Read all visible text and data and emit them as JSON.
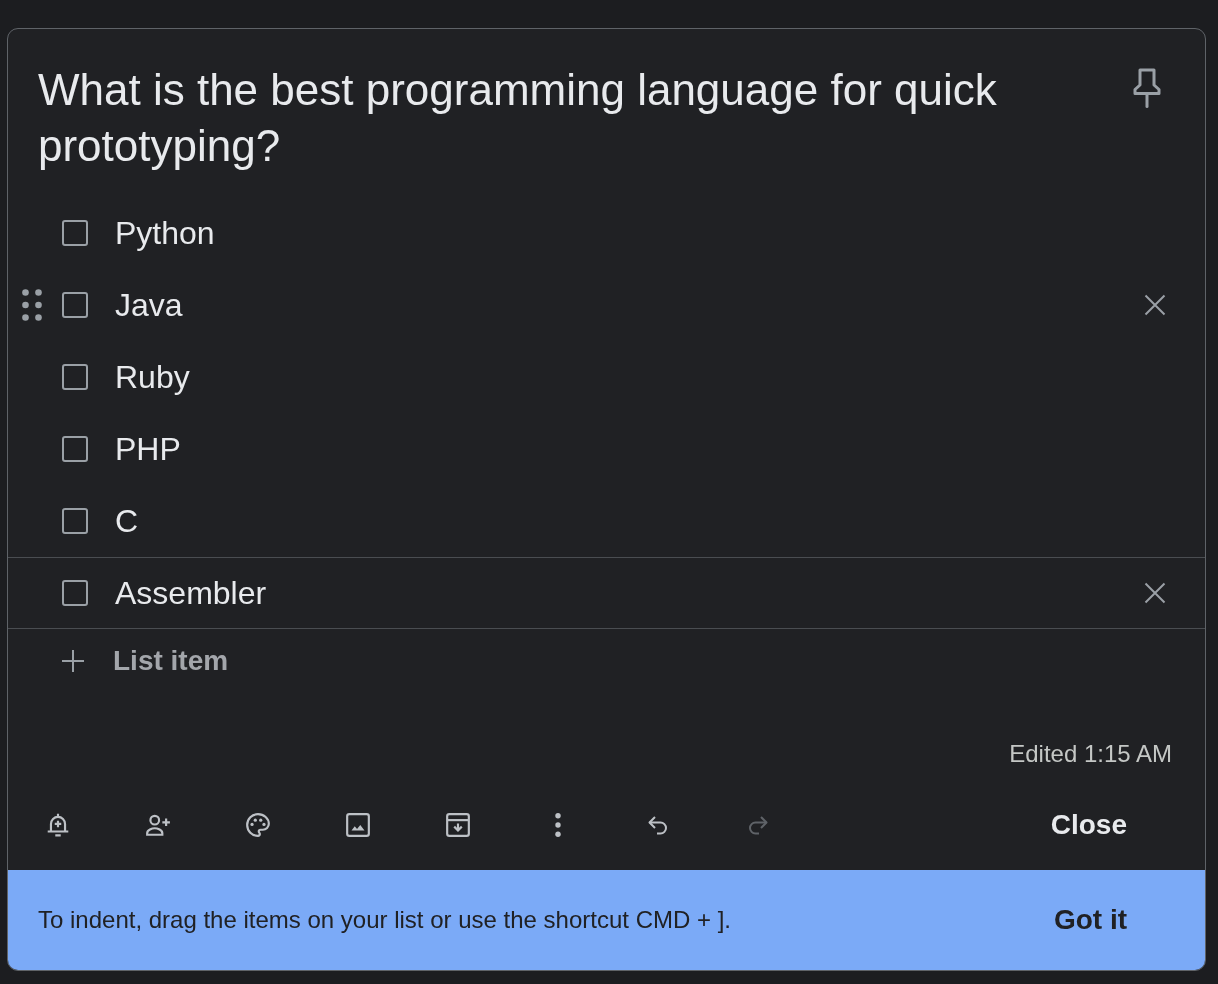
{
  "note": {
    "title": "What is the best programming language for quick prototyping?"
  },
  "items": [
    {
      "text": "Python",
      "checked": false,
      "hovered": false,
      "focused": false
    },
    {
      "text": "Java",
      "checked": false,
      "hovered": true,
      "focused": false
    },
    {
      "text": "Ruby",
      "checked": false,
      "hovered": false,
      "focused": false
    },
    {
      "text": "PHP",
      "checked": false,
      "hovered": false,
      "focused": false
    },
    {
      "text": "C",
      "checked": false,
      "hovered": false,
      "focused": false
    },
    {
      "text": "Assembler",
      "checked": false,
      "hovered": false,
      "focused": true
    }
  ],
  "new_item": {
    "placeholder": "List item"
  },
  "edited": "Edited 1:15 AM",
  "toolbar": [
    {
      "kind": "reminder",
      "disabled": false
    },
    {
      "kind": "collaborator",
      "disabled": false
    },
    {
      "kind": "color",
      "disabled": false
    },
    {
      "kind": "image",
      "disabled": false
    },
    {
      "kind": "archive",
      "disabled": false
    },
    {
      "kind": "more",
      "disabled": false
    },
    {
      "kind": "undo",
      "disabled": false
    },
    {
      "kind": "redo",
      "disabled": true
    }
  ],
  "close_button": "Close",
  "tip": {
    "text": "To indent, drag the items on your list or use the shortcut CMD + ].",
    "button": "Got it"
  }
}
